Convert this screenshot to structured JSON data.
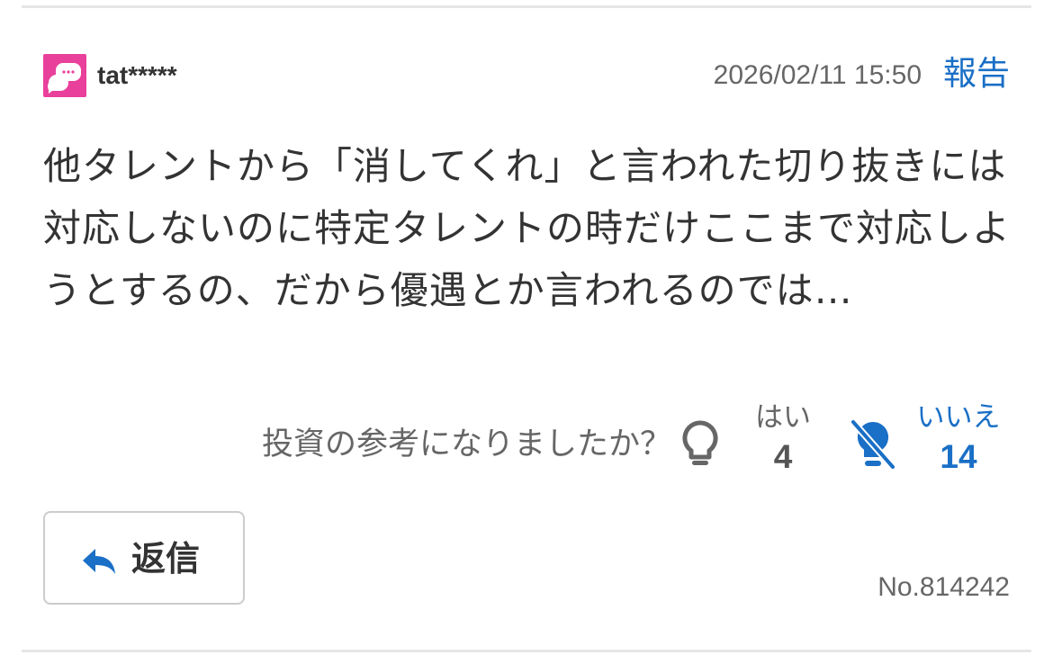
{
  "comment": {
    "username": "tat*****",
    "datetime": "2026/02/11 15:50",
    "report_label": "報告",
    "body": "他タレントから「消してくれ」と言われた切り抜きには対応しないのに特定タレントの時だけここまで対応しようとするの、だから優遇とか言われるのでは…",
    "post_number": "No.814242"
  },
  "vote": {
    "question": "投資の参考になりましたか？",
    "yes_label": "はい",
    "yes_count": "4",
    "no_label": "いいえ",
    "no_count": "14"
  },
  "actions": {
    "reply_label": "返信"
  },
  "icons": {
    "avatar": "speech-bubble-avatar-icon",
    "yes": "lightbulb-icon",
    "no": "lightbulb-off-icon",
    "reply": "reply-arrow-icon"
  },
  "colors": {
    "accent": "#1a6fc6",
    "avatar_bg": "#e9409b",
    "text": "#333333",
    "muted": "#666666",
    "divider": "#e6e6e6"
  }
}
